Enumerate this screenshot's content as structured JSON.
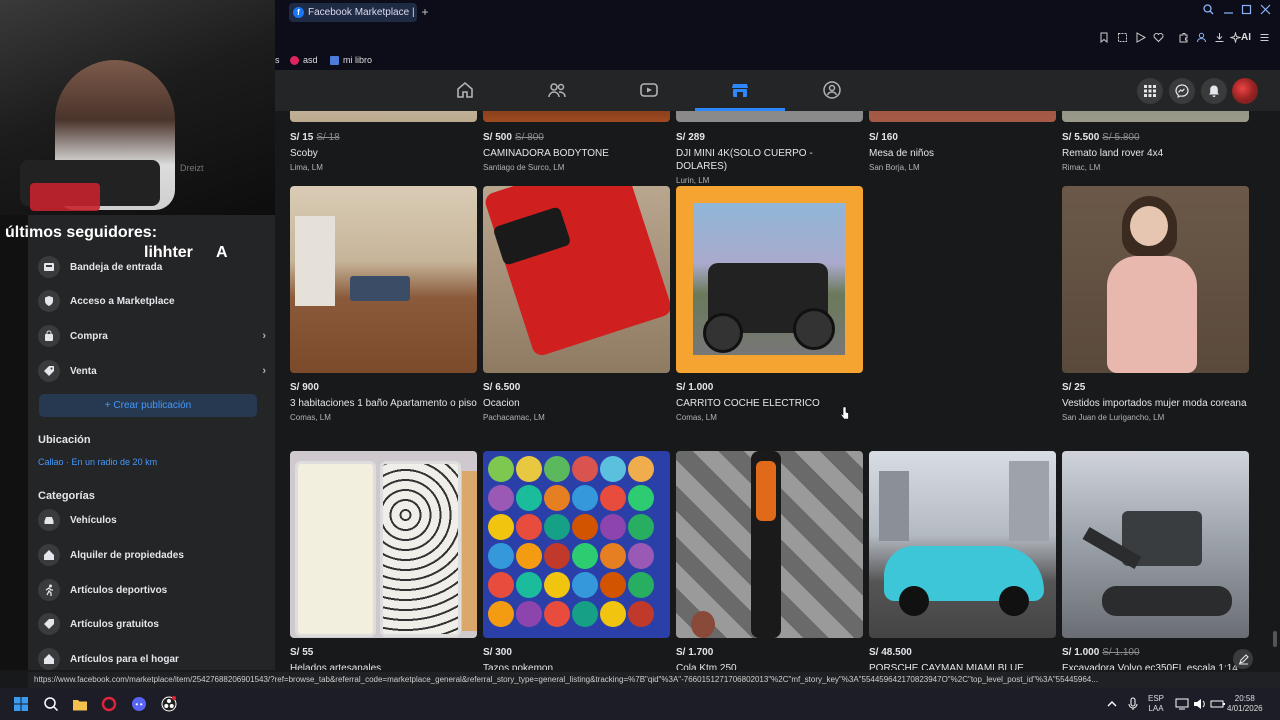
{
  "browser": {
    "tab_title": "Facebook Marketplace | F",
    "tab_plus": "+",
    "ai_label": "AI",
    "bookmarks": [
      {
        "label": "s"
      },
      {
        "label": "asd"
      },
      {
        "label": "mi libro"
      }
    ],
    "status_url": "https://www.facebook.com/marketplace/item/25427688206901543/?ref=browse_tab&referral_code=marketplace_general&referral_story_type=general_listing&tracking=%7B\"qid\"%3A\"-7660151271706802013\"%2C\"mf_story_key\"%3A\"554459642170823947O\"%2C\"top_level_post_id\"%3A\"55445964..."
  },
  "overlay": {
    "followers_label": "últimos seguidores:",
    "follower_name": "lihhter",
    "follower_initial": "A",
    "wall_text": "Dreizt"
  },
  "sidebar": {
    "items": [
      {
        "label": "Bandeja de entrada",
        "icon": "inbox-icon",
        "chevron": false
      },
      {
        "label": "Acceso a Marketplace",
        "icon": "shield-icon",
        "chevron": false
      },
      {
        "label": "Compra",
        "icon": "bag-icon",
        "chevron": true
      },
      {
        "label": "Venta",
        "icon": "tag-icon",
        "chevron": true
      }
    ],
    "create_button": "+ Crear publicación",
    "location_heading": "Ubicación",
    "location_value": "Callao · En un radio de 20 km",
    "categories_heading": "Categorías",
    "categories": [
      {
        "label": "Vehículos",
        "icon": "car-icon"
      },
      {
        "label": "Alquiler de propiedades",
        "icon": "house-dollar-icon"
      },
      {
        "label": "Artículos deportivos",
        "icon": "runner-icon"
      },
      {
        "label": "Artículos gratuitos",
        "icon": "tag-icon"
      },
      {
        "label": "Artículos para el hogar",
        "icon": "home-icon"
      }
    ]
  },
  "listings_row1": [
    {
      "price": "S/ 15",
      "old_price": "S/ 18",
      "title": "Scoby",
      "location": "Lima, LM"
    },
    {
      "price": "S/ 500",
      "old_price": "S/ 800",
      "title": "CAMINADORA BODYTONE",
      "location": "Santiago de Surco, LM"
    },
    {
      "price": "S/ 289",
      "old_price": "",
      "title": "DJI MINI 4K(SOLO CUERPO - DOLARES)",
      "location": "Lurin, LM"
    },
    {
      "price": "S/ 160",
      "old_price": "",
      "title": "Mesa de niños",
      "location": "San Borja, LM"
    },
    {
      "price": "S/ 5.500",
      "old_price": "S/ 5.800",
      "title": "Remato land rover 4x4",
      "location": "Rimac, LM"
    }
  ],
  "listings_row2": [
    {
      "price": "S/ 900",
      "title": "3 habitaciones 1 baño Apartamento o piso",
      "location": "Comas, LM"
    },
    {
      "price": "S/ 6.500",
      "title": "Ocacion",
      "location": "Pachacamac, LM"
    },
    {
      "price": "S/ 1.000",
      "title": "CARRITO COCHE ELECTRICO",
      "location": "Comas, LM"
    },
    {
      "price": "S/ 25",
      "title": "Vestidos importados mujer moda coreana",
      "location": "San Juan de Lurigancho, LM"
    }
  ],
  "listings_row3": [
    {
      "price": "S/ 55",
      "old_price": "",
      "title": "Helados artesanales"
    },
    {
      "price": "S/ 300",
      "old_price": "",
      "title": "Tazos pokemon"
    },
    {
      "price": "S/ 1.700",
      "old_price": "",
      "title": "Cola Ktm 250"
    },
    {
      "price": "S/ 48.500",
      "old_price": "",
      "title": "PORSCHE CAYMAN MIAMI BLUE"
    },
    {
      "price": "S/ 1.000",
      "old_price": "S/ 1.100",
      "title": "Excavadora Volvo ec350EL escala 1:14"
    }
  ],
  "taskbar": {
    "lang_top": "ESP",
    "lang_bottom": "LAA",
    "time": "20:58",
    "date": "4/01/2026"
  },
  "colors": {
    "accent": "#2d88ff",
    "link": "#4599ff",
    "background": "#18191a",
    "surface": "#242526"
  }
}
